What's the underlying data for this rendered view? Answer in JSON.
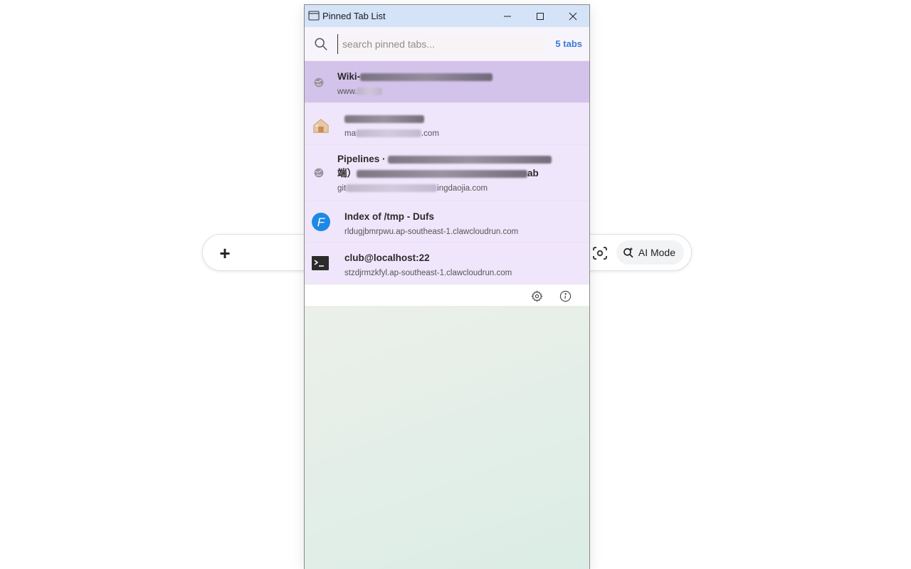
{
  "background": {
    "plus_label": "+",
    "ai_mode_label": "AI Mode"
  },
  "window": {
    "title": "Pinned Tab List"
  },
  "search": {
    "placeholder": "search pinned tabs...",
    "value": "",
    "count_label": "5 tabs"
  },
  "tabs": [
    {
      "title_prefix": "Wiki-",
      "url_prefix": "www.",
      "url_suffix": "",
      "icon": "globe-icon",
      "active": true
    },
    {
      "title_prefix": "",
      "url_prefix": "ma",
      "url_suffix": ".com",
      "icon": "house-icon",
      "active": false
    },
    {
      "title_prefix": "Pipelines · ",
      "title_line2_prefix": "端）",
      "title_line2_suffix": "ab",
      "url_prefix": "git",
      "url_suffix": "ingdaojia.com",
      "icon": "globe-icon",
      "active": false
    },
    {
      "title": "Index of /tmp - Dufs",
      "url": "rldugjbmrpwu.ap-southeast-1.clawcloudrun.com",
      "icon": "dufs-f-icon",
      "active": false
    },
    {
      "title": "club@localhost:22",
      "url": "stzdjrmzkfyl.ap-southeast-1.clawcloudrun.com",
      "icon": "terminal-icon",
      "active": false
    }
  ],
  "colors": {
    "accent": "#3a7bd5",
    "titlebar": "#d5e3f8",
    "list_bg": "#f0e6fb",
    "active_row": "#d3c3ea"
  }
}
